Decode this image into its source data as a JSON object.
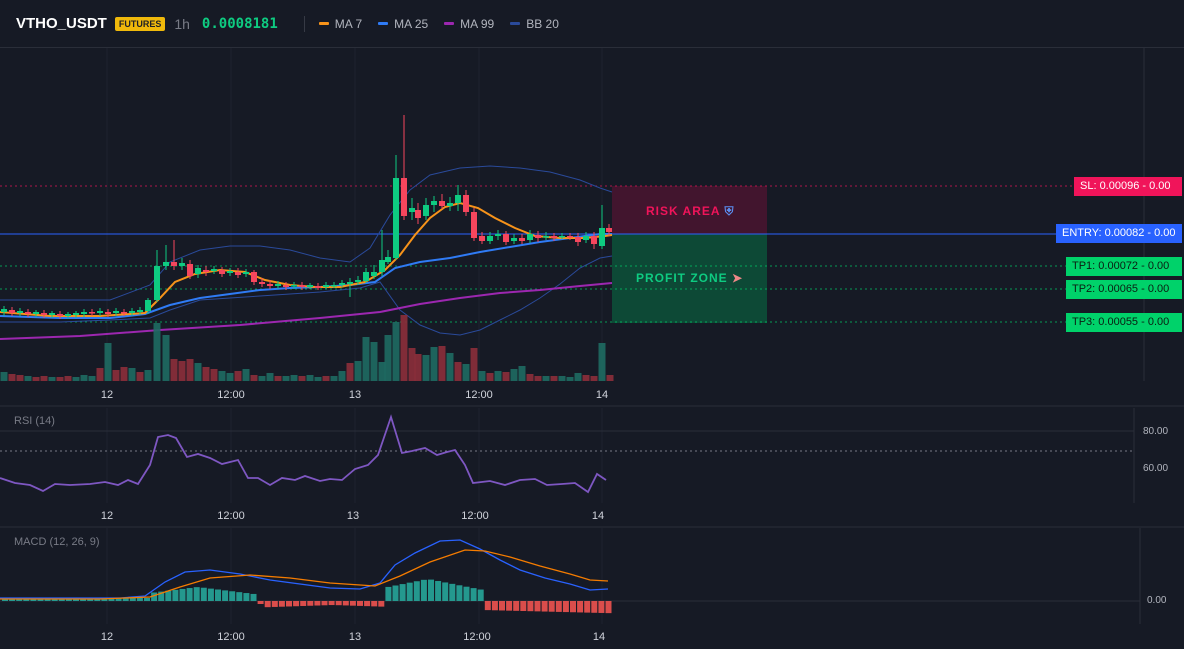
{
  "header": {
    "symbol": "VTHO_USDT",
    "badge": "FUTURES",
    "timeframe": "1h",
    "price": "0.0008181",
    "indicators": [
      {
        "label": "MA 7",
        "color": "#f7931a"
      },
      {
        "label": "MA 25",
        "color": "#2f7bf5"
      },
      {
        "label": "MA 99",
        "color": "#9c27b0"
      },
      {
        "label": "BB 20",
        "color": "#2a4a9a"
      }
    ]
  },
  "levels": {
    "sl": {
      "label": "SL: 0.00096 - 0.00",
      "color": "#f0145a"
    },
    "entry": {
      "label": "ENTRY: 0.00082 - 0.00",
      "color": "#2962ff"
    },
    "tp1": {
      "label": "TP1: 0.00072 - 0.00",
      "color": "#00d26a"
    },
    "tp2": {
      "label": "TP2: 0.00065 - 0.00",
      "color": "#00d26a"
    },
    "tp3": {
      "label": "TP3: 0.00055 - 0.00",
      "color": "#00d26a"
    }
  },
  "zones": {
    "risk": {
      "label": "RISK AREA",
      "icon": "shield-icon"
    },
    "profit": {
      "label": "PROFIT ZONE",
      "icon": "rocket-icon"
    }
  },
  "x_axis": {
    "ticks": [
      "12",
      "12:00",
      "13",
      "12:00",
      "14"
    ]
  },
  "rsi": {
    "title": "RSI (14)",
    "ticks": [
      "80.00",
      "60.00"
    ]
  },
  "macd": {
    "title": "MACD (12, 26, 9)",
    "ticks": [
      "0.00"
    ]
  },
  "colors": {
    "up": "#26a69a",
    "down": "#ef5350",
    "candle_up": "#0ecb81",
    "candle_down": "#f6465d",
    "rsi_line": "#7e57c2",
    "macd_line": "#2962ff",
    "signal_line": "#f57c00"
  }
}
